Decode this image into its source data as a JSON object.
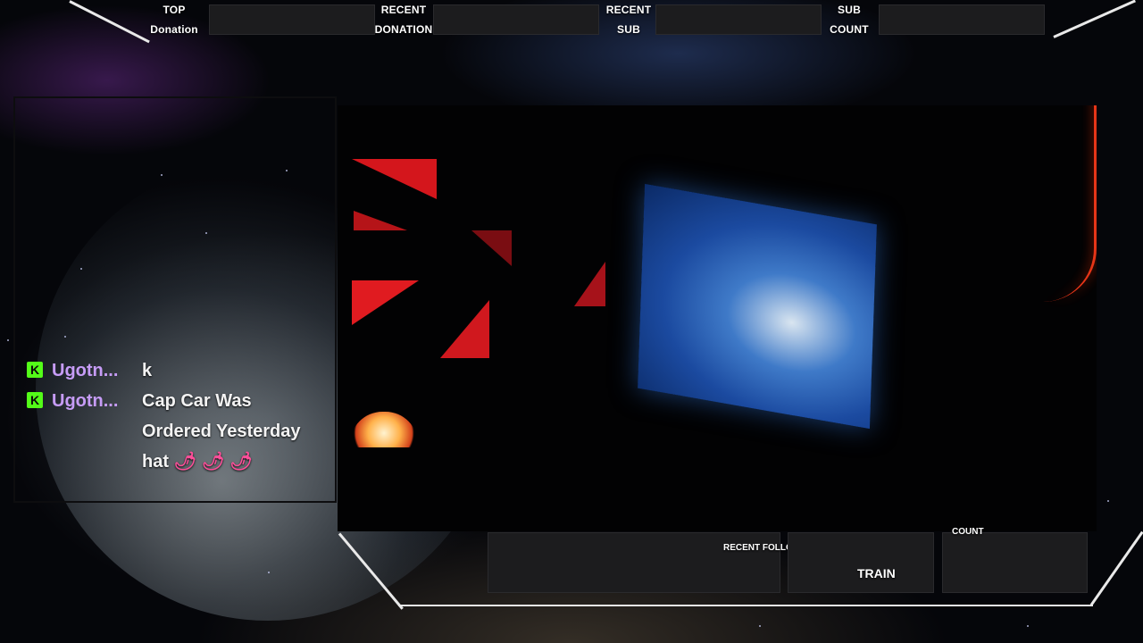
{
  "top_bar": {
    "labels": [
      {
        "line1": "TOP",
        "line2": "Donation"
      },
      {
        "line1": "RECENT",
        "line2": "DONATION"
      },
      {
        "line1": "RECENT",
        "line2": "SUB"
      },
      {
        "line1": "SUB",
        "line2": "COUNT"
      }
    ]
  },
  "chat": {
    "messages": [
      {
        "user": "Ugotn...",
        "badge": "K",
        "text": "k"
      },
      {
        "user": "Ugotn...",
        "badge": "K",
        "text_line1": "Cap Car Was",
        "text_line2": "Ordered Yesterday",
        "text_line3": "hat",
        "emotes": "🌶🌶🌶"
      }
    ],
    "badge_color": "#53fc18",
    "username_color": "#c79cf7"
  },
  "bottom_bar": {
    "recent_follower_label": "RECENT FOLLOWER",
    "train_label": "TRAIN",
    "count_label": "COUNT"
  },
  "colors": {
    "panel_bg": "#1c1c1e",
    "frame_line": "#e9e9e9",
    "accent_red": "#ff2a1a"
  }
}
